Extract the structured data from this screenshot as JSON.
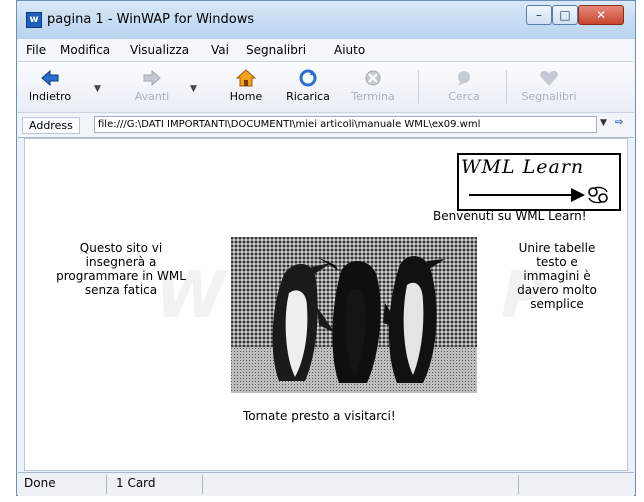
{
  "window": {
    "title": "pagina 1 - WinWAP for Windows",
    "app_icon": "w",
    "controls": {
      "minimize": "–",
      "maximize": "□",
      "close": "✕"
    }
  },
  "menu": [
    "File",
    "Modifica",
    "Visualizza",
    "Vai",
    "Segnalibri",
    "Aiuto"
  ],
  "toolbar": {
    "back": "Indietro",
    "forward": "Avanti",
    "home": "Home",
    "reload": "Ricarica",
    "stop": "Termina",
    "search": "Cerca",
    "bookmarks": "Segnalibri"
  },
  "address": {
    "label": "Address",
    "value": "file:///G:\\DATI IMPORTANTI\\DOCUMENTI\\miei articoli\\manuale WML\\ex09.wml"
  },
  "page": {
    "logo_text": "WML Learn",
    "welcome": "Benvenuti su WML Learn!",
    "left_text": "Questo sito vi insegnerà a programmare in WML senza fatica",
    "right_text": "Unire tabelle testo e immagini è davero molto semplice",
    "goodbye": "Tornate presto a visitarci!",
    "watermark": "WinWAP"
  },
  "status": {
    "state": "Done",
    "cards": "1 Card"
  },
  "icons": {
    "back": "back-arrow-icon",
    "forward": "forward-arrow-icon",
    "home": "home-icon",
    "reload": "reload-icon",
    "stop": "stop-icon",
    "search": "search-icon",
    "bookmarks": "heart-icon",
    "logo": "arrow-cancer-symbol-icon"
  },
  "colors": {
    "accent": "#1f5fb8",
    "title_bar": "#c4dbf2",
    "close_button": "#c8452e"
  }
}
